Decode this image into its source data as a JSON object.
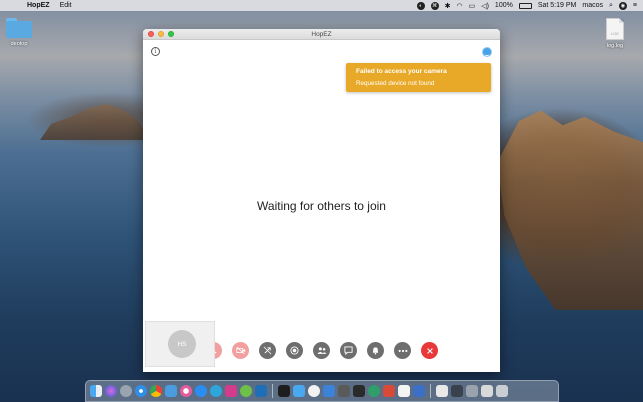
{
  "menubar": {
    "app_name": "HopEZ",
    "menu_items": [
      "Edit"
    ],
    "battery": "100%",
    "clock": "Sat 5:19 PM",
    "user": "macos"
  },
  "desktop": {
    "folder_label": "deotop",
    "file_label": "log.log",
    "file_badge": "LOG"
  },
  "window": {
    "title": "HopEZ",
    "toast": {
      "title": "Failed to access your camera",
      "message": "Requested device not found",
      "color": "#e9a928"
    },
    "waiting_text": "Waiting for others to join",
    "self_initials": "HS",
    "controls": [
      {
        "name": "mic-toggle",
        "icon": "mic-off-icon"
      },
      {
        "name": "camera-toggle",
        "icon": "camera-off-icon"
      },
      {
        "name": "screen-share",
        "icon": "share-off-icon"
      },
      {
        "name": "record",
        "icon": "record-icon"
      },
      {
        "name": "participants",
        "icon": "people-icon"
      },
      {
        "name": "chat",
        "icon": "chat-icon"
      },
      {
        "name": "notifications",
        "icon": "bell-icon"
      },
      {
        "name": "more",
        "icon": "more-icon"
      },
      {
        "name": "leave-call",
        "icon": "close-icon",
        "color": "#e8393a"
      }
    ]
  },
  "dock": {
    "icons": [
      "finder",
      "siri",
      "launchpad",
      "safari",
      "chrome",
      "mail",
      "itunes",
      "app-store",
      "telegram",
      "firefox",
      "android-studio",
      "vscode",
      "terminal",
      "finder-2",
      "notes",
      "reminders",
      "keychain",
      "activity-monitor",
      "sourcetree",
      "preview",
      "document",
      "downloads",
      "trash"
    ]
  }
}
